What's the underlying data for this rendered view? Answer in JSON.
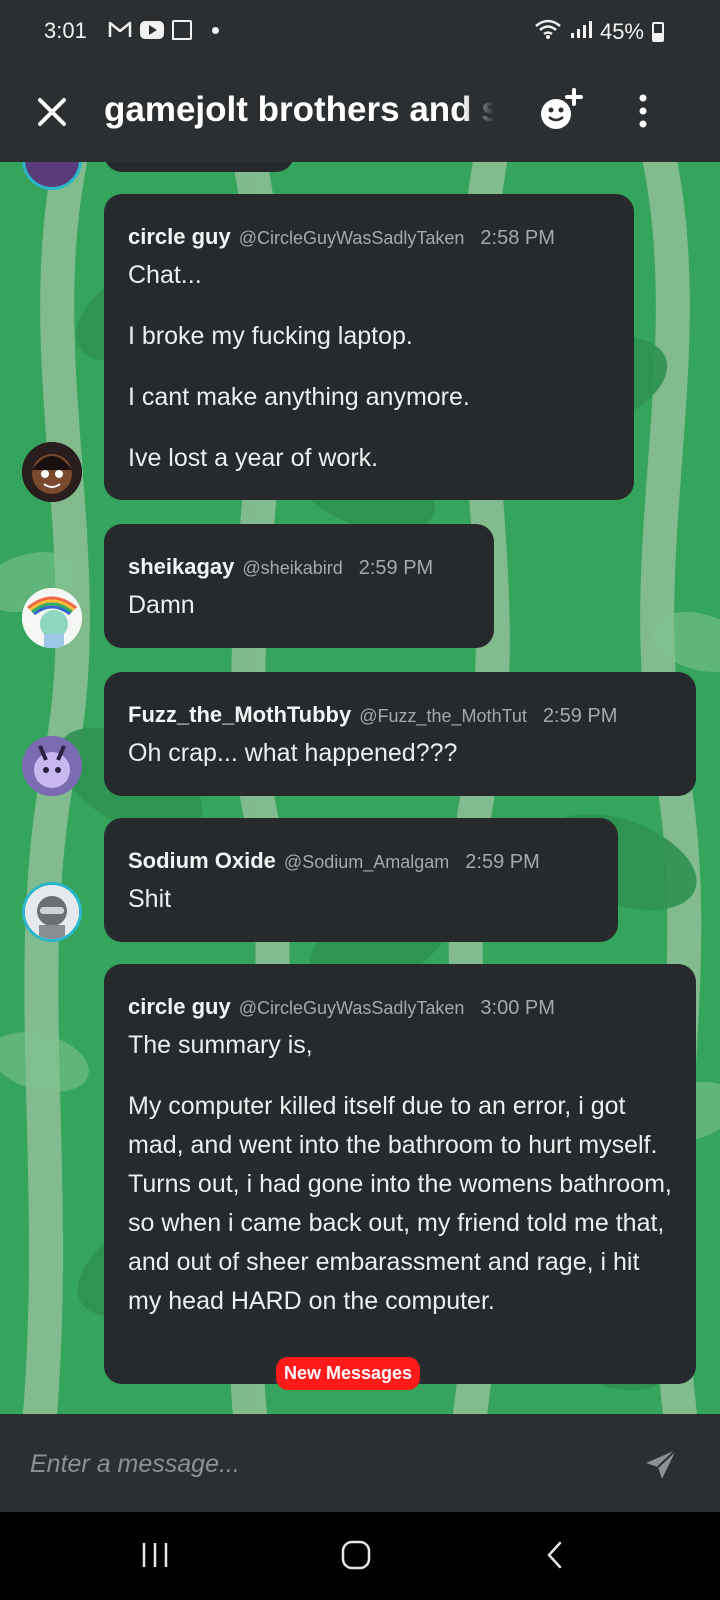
{
  "status_bar": {
    "time": "3:01",
    "battery": "45%",
    "app_icons": [
      "gmail-icon",
      "youtube-icon",
      "twitch-icon",
      "notification-dot-icon"
    ],
    "system_icons": [
      "wifi-icon",
      "signal-icon",
      "battery-icon"
    ]
  },
  "header": {
    "title": "gamejolt brothers and s",
    "icons": [
      "close-icon",
      "add-emoji-icon",
      "more-vertical-icon"
    ]
  },
  "messages": [
    {
      "author": "circle guy",
      "handle": "@CircleGuyWasSadlyTaken",
      "time": "2:58 PM",
      "lines": [
        "Chat...",
        "I broke my fucking laptop.",
        "I cant make anything anymore.",
        "Ive lost a year of work."
      ]
    },
    {
      "author": "sheikagay",
      "handle": "@sheikabird",
      "time": "2:59 PM",
      "lines": [
        "Damn"
      ]
    },
    {
      "author": "Fuzz_the_MothTubby",
      "handle": "@Fuzz_the_MothTut",
      "time": "2:59 PM",
      "lines": [
        "Oh crap... what happened???"
      ]
    },
    {
      "author": "Sodium Oxide",
      "handle": "@Sodium_Amalgam",
      "time": "2:59 PM",
      "lines": [
        "Shit"
      ]
    },
    {
      "author": "circle guy",
      "handle": "@CircleGuyWasSadlyTaken",
      "time": "3:00 PM",
      "lines": [
        "The summary is,",
        "My computer killed itself due to an error, i got mad, and went into the bathroom to hurt myself. Turns out, i had gone into the womens bathroom, so when i came back out, my friend told me that, and out of sheer embarassment and rage, i hit my head HARD on the computer."
      ]
    }
  ],
  "new_messages_badge": "New Messages",
  "composer": {
    "placeholder": "Enter a message..."
  },
  "colors": {
    "chat_background": "#33a35a",
    "bubble": "#262a2c",
    "header": "#2b2f31",
    "badge": "#ff1a1a"
  }
}
